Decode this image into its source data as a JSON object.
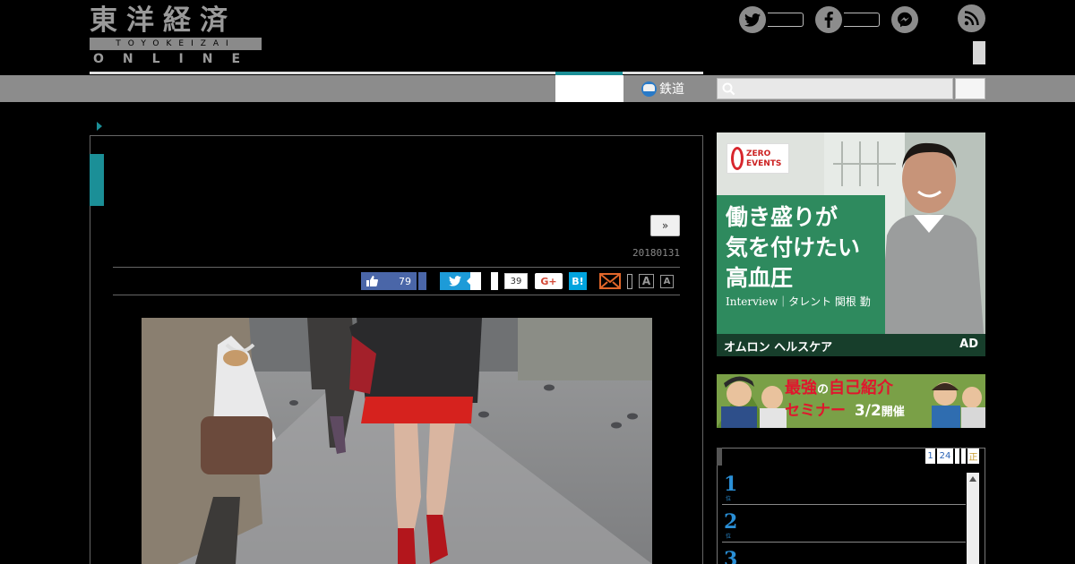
{
  "logo": {
    "kanji": "東洋経済",
    "romaji": "TOYOKEIZAI",
    "online": "ONLINE"
  },
  "social_icons": [
    "twitter-icon",
    "facebook-icon",
    "messenger-icon",
    "rss-icon"
  ],
  "nav": {
    "rail_label": "鉄道",
    "search_placeholder": ""
  },
  "article": {
    "next_label": "»",
    "date": "20180131",
    "share": {
      "like_count": "79",
      "hatena_count": "39",
      "gplus_label": "G+",
      "hatena_label": "B!",
      "font_large": "A",
      "font_small": "A"
    }
  },
  "ads": {
    "main": {
      "brand_badge": "ZERO EVENTS",
      "headline": [
        "働き盛りが",
        "気を付けたい",
        "高血圧"
      ],
      "subline": "Interview｜タレント 関根 勤",
      "sponsor": "オムロン ヘルスケア",
      "ad_label": "AD"
    },
    "seminar": {
      "line1_prefix": "最強",
      "line1_mid": "の",
      "line1_suffix": "自己紹介",
      "line2": "セミナー",
      "date_text": "3/2",
      "date_suffix": "開催"
    }
  },
  "ranking": {
    "tabs": [
      "1",
      "24",
      "",
      "",
      "正"
    ],
    "items": [
      {
        "rank": "1",
        "suffix": "位"
      },
      {
        "rank": "2",
        "suffix": "位"
      },
      {
        "rank": "3",
        "suffix": "位"
      }
    ]
  },
  "colors": {
    "accent_teal": "#1b8f97",
    "nav_gray": "#8c8c8c",
    "facebook": "#4a66a8",
    "twitter": "#1d9bd8",
    "hatena": "#00a4de",
    "ad_green": "#2e8a5e"
  }
}
